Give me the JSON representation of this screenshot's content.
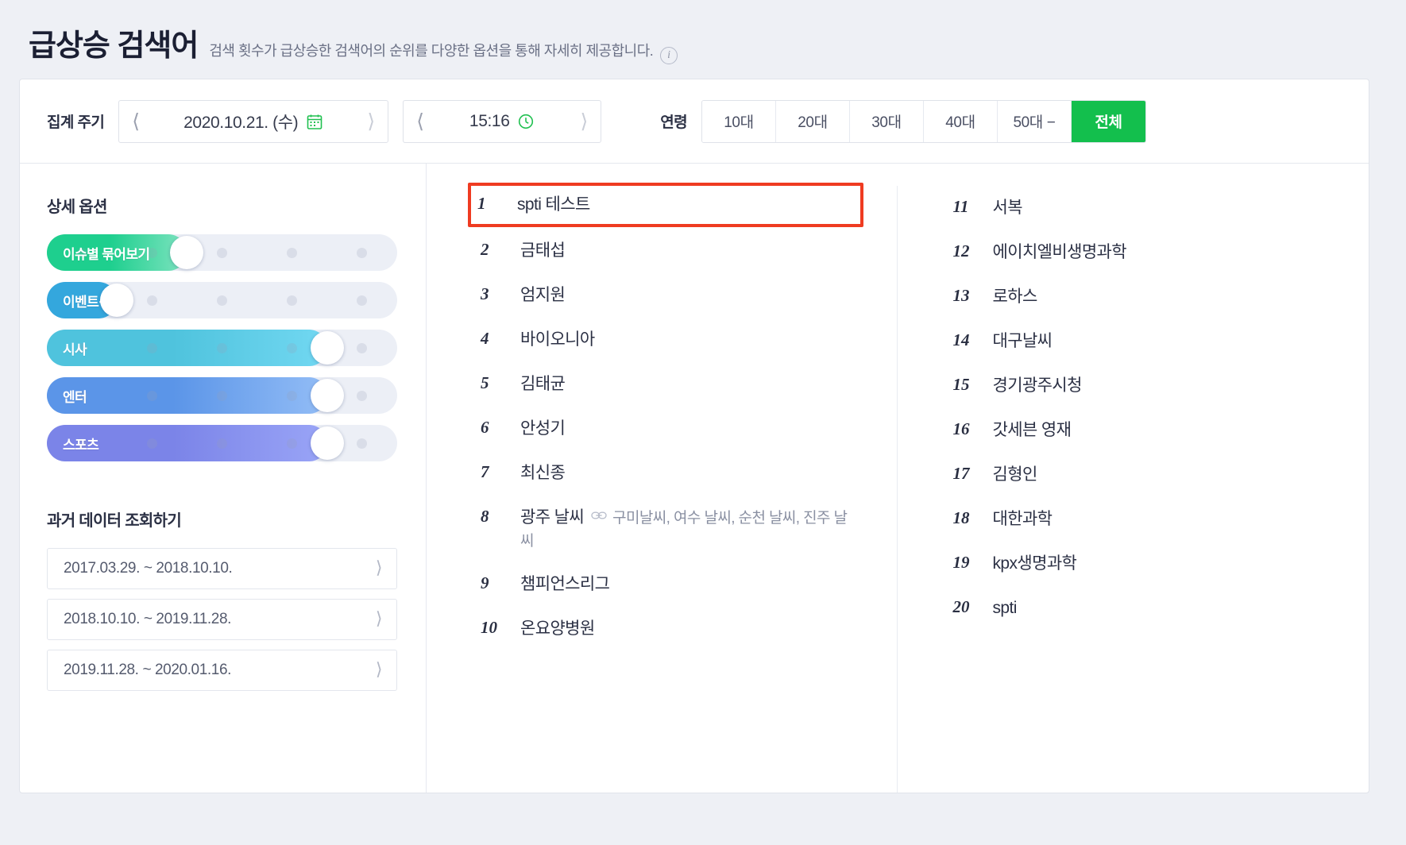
{
  "header": {
    "title": "급상승 검색어",
    "subtitle": "검색 횟수가 급상승한 검색어의 순위를 다양한 옵션을 통해 자세히 제공합니다.",
    "info_icon": "info-icon"
  },
  "filters": {
    "period_label": "집계 주기",
    "date_value": "2020.10.21. (수)",
    "time_value": "15:16",
    "prev_icon": "chevron-left-icon",
    "next_icon": "chevron-right-icon",
    "calendar_icon": "calendar-icon",
    "clock_icon": "clock-icon",
    "age_label": "연령",
    "age_options": [
      {
        "label": "10대",
        "active": false
      },
      {
        "label": "20대",
        "active": false
      },
      {
        "label": "30대",
        "active": false
      },
      {
        "label": "40대",
        "active": false
      },
      {
        "label": "50대 −",
        "active": false
      },
      {
        "label": "전체",
        "active": true
      }
    ],
    "accent_color": "#13bf4d"
  },
  "options": {
    "title": "상세 옵션",
    "sliders": [
      {
        "label": "이슈별 묶어보기",
        "steps": 5,
        "value": 2,
        "color_from": "#1ecf8e",
        "color_to": "#7fe3c0"
      },
      {
        "label": "이벤트·할인",
        "steps": 5,
        "value": 1,
        "color_from": "#34a7dd",
        "color_to": "#34a7dd"
      },
      {
        "label": "시사",
        "steps": 5,
        "value": 4,
        "color_from": "#4fc3dd",
        "color_to": "#72d8f2"
      },
      {
        "label": "엔터",
        "steps": 5,
        "value": 4,
        "color_from": "#5b95e8",
        "color_to": "#93bdf6"
      },
      {
        "label": "스포츠",
        "steps": 5,
        "value": 4,
        "color_from": "#7b84e8",
        "color_to": "#9aa5f7"
      }
    ]
  },
  "history": {
    "title": "과거 데이터 조회하기",
    "items": [
      {
        "label": "2017.03.29. ~ 2018.10.10."
      },
      {
        "label": "2018.10.10. ~ 2019.11.28."
      },
      {
        "label": "2019.11.28. ~ 2020.01.16."
      }
    ],
    "chevron_icon": "chevron-right-icon"
  },
  "ranking": {
    "highlight_color": "#ef3b21",
    "link_icon": "link-icon",
    "column_left": [
      {
        "rank": "1",
        "keyword": "spti 테스트",
        "related": "",
        "highlighted": true
      },
      {
        "rank": "2",
        "keyword": "금태섭",
        "related": "",
        "highlighted": false
      },
      {
        "rank": "3",
        "keyword": "엄지원",
        "related": "",
        "highlighted": false
      },
      {
        "rank": "4",
        "keyword": "바이오니아",
        "related": "",
        "highlighted": false
      },
      {
        "rank": "5",
        "keyword": "김태균",
        "related": "",
        "highlighted": false
      },
      {
        "rank": "6",
        "keyword": "안성기",
        "related": "",
        "highlighted": false
      },
      {
        "rank": "7",
        "keyword": "최신종",
        "related": "",
        "highlighted": false
      },
      {
        "rank": "8",
        "keyword": "광주 날씨",
        "related": "구미날씨, 여수 날씨, 순천 날씨, 진주 날씨",
        "highlighted": false
      },
      {
        "rank": "9",
        "keyword": "챔피언스리그",
        "related": "",
        "highlighted": false
      },
      {
        "rank": "10",
        "keyword": "온요양병원",
        "related": "",
        "highlighted": false
      }
    ],
    "column_right": [
      {
        "rank": "11",
        "keyword": "서복",
        "related": "",
        "highlighted": false
      },
      {
        "rank": "12",
        "keyword": "에이치엘비생명과학",
        "related": "",
        "highlighted": false
      },
      {
        "rank": "13",
        "keyword": "로하스",
        "related": "",
        "highlighted": false
      },
      {
        "rank": "14",
        "keyword": "대구날씨",
        "related": "",
        "highlighted": false
      },
      {
        "rank": "15",
        "keyword": "경기광주시청",
        "related": "",
        "highlighted": false
      },
      {
        "rank": "16",
        "keyword": "갓세븐 영재",
        "related": "",
        "highlighted": false
      },
      {
        "rank": "17",
        "keyword": "김형인",
        "related": "",
        "highlighted": false
      },
      {
        "rank": "18",
        "keyword": "대한과학",
        "related": "",
        "highlighted": false
      },
      {
        "rank": "19",
        "keyword": "kpx생명과학",
        "related": "",
        "highlighted": false
      },
      {
        "rank": "20",
        "keyword": "spti",
        "related": "",
        "highlighted": false
      }
    ]
  }
}
